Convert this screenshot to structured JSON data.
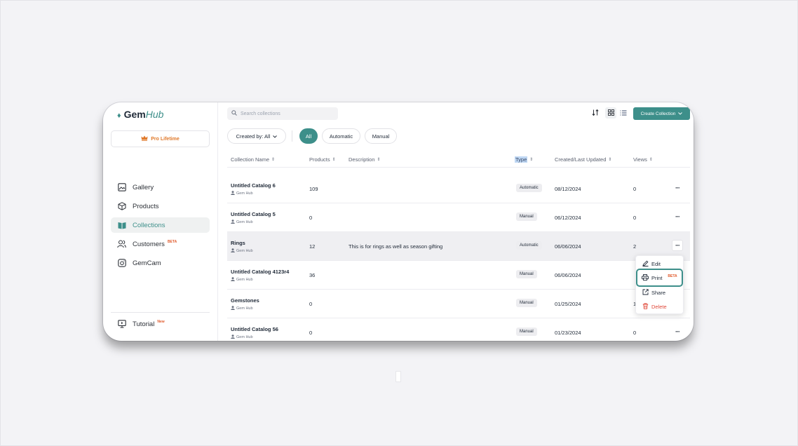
{
  "app": {
    "logo_gem": "Gem",
    "logo_hub": "Hub",
    "pro_label": "Pro Lifetime"
  },
  "sidebar": {
    "items": [
      {
        "label": "Gallery",
        "icon": "image-icon"
      },
      {
        "label": "Products",
        "icon": "box-icon"
      },
      {
        "label": "Collections",
        "icon": "book-icon",
        "active": true
      },
      {
        "label": "Customers",
        "icon": "users-icon",
        "badge": "BETA"
      },
      {
        "label": "GemCam",
        "icon": "camera-icon"
      }
    ],
    "tutorial": {
      "label": "Tutorial",
      "badge": "New"
    }
  },
  "toolbar": {
    "search_placeholder": "Search collections",
    "create_label": "Create Collection"
  },
  "filters": {
    "created_by": "Created by: All",
    "chips": [
      "All",
      "Automatic",
      "Manual"
    ],
    "active_chip": "All"
  },
  "table": {
    "headers": [
      "Collection Name",
      "Products",
      "Description",
      "Type",
      "Created/Last Updated",
      "Views"
    ],
    "rows": [
      {
        "name": "Untitled Catalog 6",
        "owner": "Gem Hub",
        "products": "109",
        "description": "",
        "type": "Automatic",
        "date": "08/12/2024",
        "views": "0"
      },
      {
        "name": "Untitled Catalog 5",
        "owner": "Gem Hub",
        "products": "0",
        "description": "",
        "type": "Manual",
        "date": "06/12/2024",
        "views": "0"
      },
      {
        "name": "Rings",
        "owner": "Gem Hub",
        "products": "12",
        "description": "This is for rings as well as season gifting",
        "type": "Automatic",
        "date": "06/06/2024",
        "views": "2"
      },
      {
        "name": "Untitled Catalog 4123r4",
        "owner": "Gem Hub",
        "products": "36",
        "description": "",
        "type": "Manual",
        "date": "06/06/2024",
        "views": ""
      },
      {
        "name": "Gemstones",
        "owner": "Gem Hub",
        "products": "0",
        "description": "",
        "type": "Manual",
        "date": "01/25/2024",
        "views": "1"
      },
      {
        "name": "Untitled Catalog 56",
        "owner": "Gem Hub",
        "products": "0",
        "description": "",
        "type": "Manual",
        "date": "01/23/2024",
        "views": "0"
      }
    ],
    "more_label": "···"
  },
  "context_menu": {
    "edit": "Edit",
    "print": "Print",
    "print_badge": "BETA",
    "share": "Share",
    "delete": "Delete"
  },
  "colors": {
    "accent": "#3d8f8a",
    "danger": "#e04a3b",
    "pro": "#e07a2c"
  }
}
